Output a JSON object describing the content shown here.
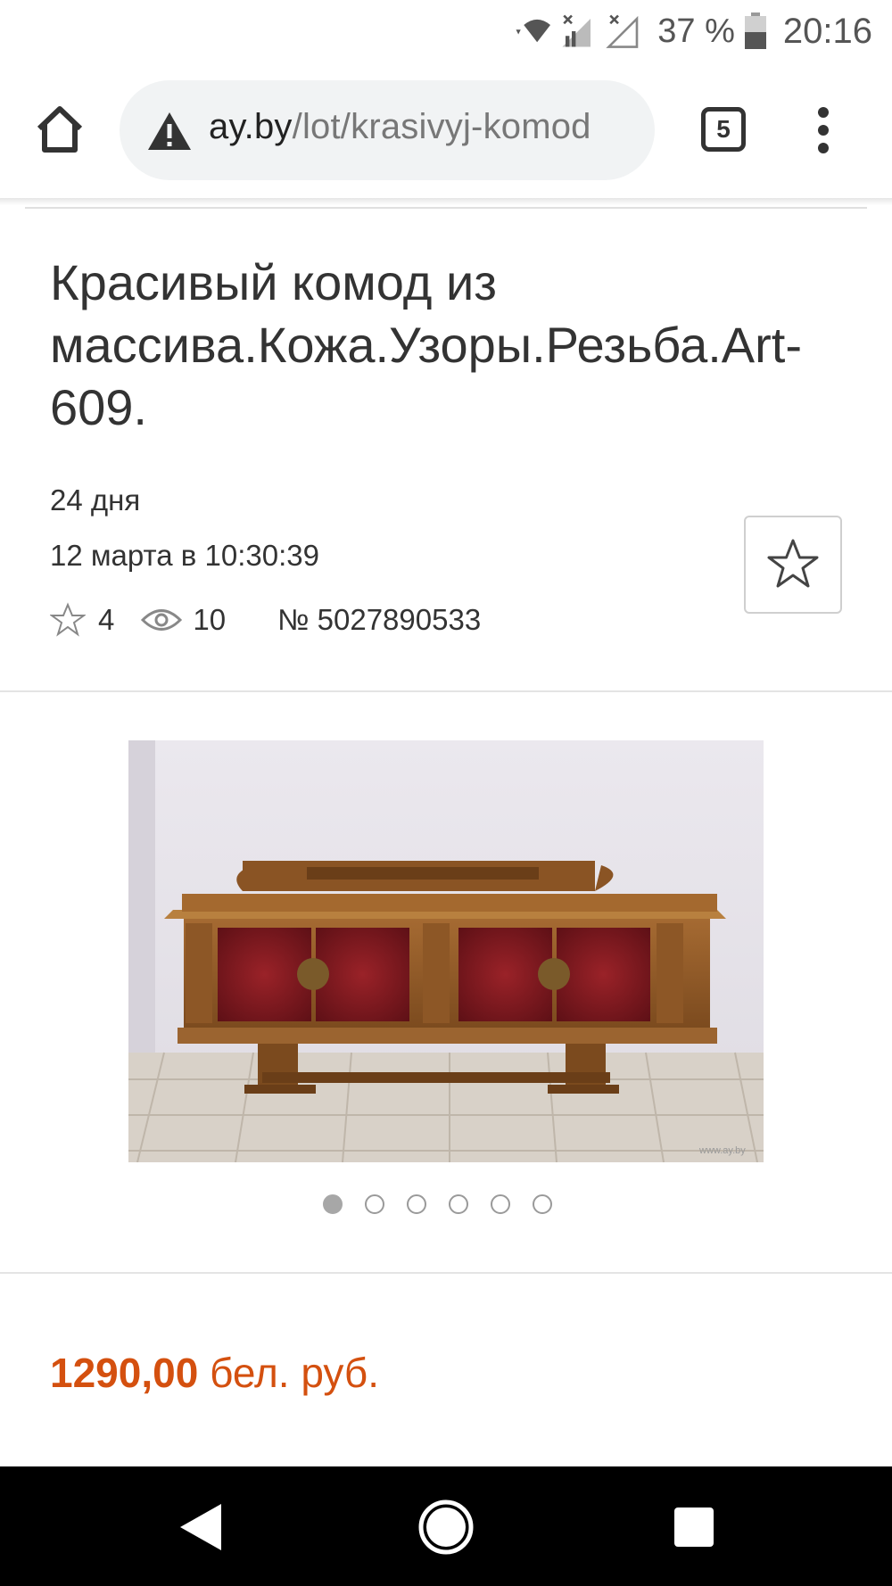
{
  "status_bar": {
    "battery": "37 %",
    "time": "20:16"
  },
  "browser": {
    "url_domain": "ay.by",
    "url_path": "/lot/krasivyj-komod",
    "tab_count": "5"
  },
  "lot": {
    "title": "Красивый комод из массива.Кожа.Узоры.Резьба.Art-609.",
    "time_left": "24 дня",
    "end_date": "12 марта в 10:30:39",
    "favorites_count": "4",
    "views_count": "10",
    "lot_number": "№ 5027890533"
  },
  "gallery": {
    "total_images": 6,
    "active_index": 0,
    "watermark": "www.ay.by"
  },
  "price": {
    "amount": "1290,00",
    "currency": "бел. руб."
  },
  "icons": {
    "home": "home-icon",
    "warning": "warning-icon",
    "menu": "more-vert-icon",
    "star": "star-outline-icon",
    "eye": "eye-icon"
  },
  "colors": {
    "price": "#d4500f",
    "nav_bar": "#000000"
  }
}
